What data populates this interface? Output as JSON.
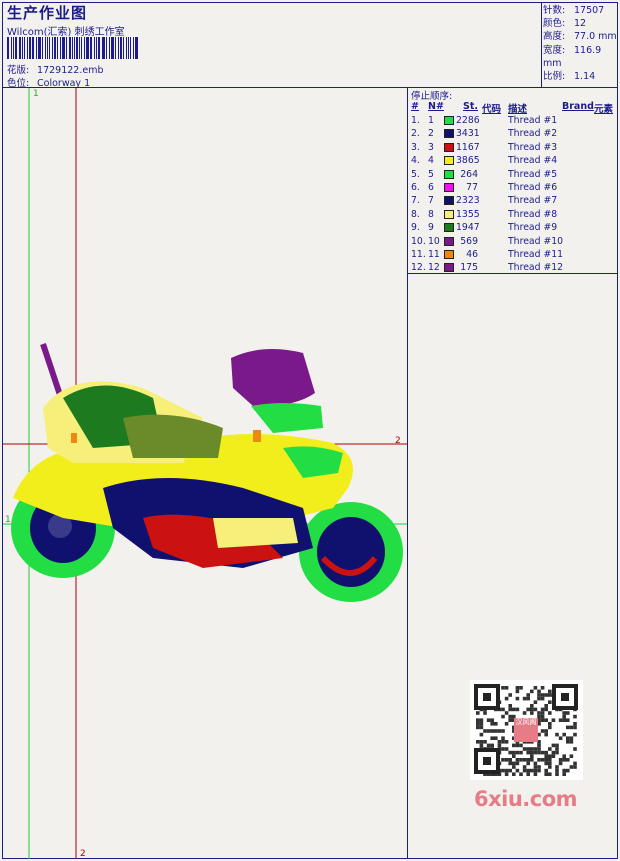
{
  "header": {
    "title": "生产作业图",
    "subtitle": "Wilcom(汇索) 刺绣工作室",
    "design_label": "花版:",
    "design_value": "1729122.emb",
    "colorway_label": "色位:",
    "colorway_value": "Colorway 1"
  },
  "stats": [
    {
      "label": "针数:",
      "value": "17507"
    },
    {
      "label": "颜色:",
      "value": "12"
    },
    {
      "label": "高度:",
      "value": "77.0 mm"
    },
    {
      "label": "宽度:",
      "value": "116.9 mm"
    },
    {
      "label": "比例:",
      "value": "1.14"
    }
  ],
  "stop_sequence": {
    "title": "停止顺序:",
    "headers": {
      "seq": "#",
      "num": "N#",
      "stitches": "St.",
      "code": "代码",
      "desc": "描述",
      "brand": "Brand",
      "element": "元素"
    },
    "rows": [
      {
        "seq": "1.",
        "num": "1",
        "color": "#22dd44",
        "stitches": "2286",
        "desc": "Thread #1"
      },
      {
        "seq": "2.",
        "num": "2",
        "color": "#10106e",
        "stitches": "3431",
        "desc": "Thread #2"
      },
      {
        "seq": "3.",
        "num": "3",
        "color": "#cc1111",
        "stitches": "1167",
        "desc": "Thread #3"
      },
      {
        "seq": "4.",
        "num": "4",
        "color": "#f2ee1c",
        "stitches": "3865",
        "desc": "Thread #4"
      },
      {
        "seq": "5.",
        "num": "5",
        "color": "#22dd44",
        "stitches": "264",
        "desc": "Thread #5"
      },
      {
        "seq": "6.",
        "num": "6",
        "color": "#ee11ee",
        "stitches": "77",
        "desc": "Thread #6"
      },
      {
        "seq": "7.",
        "num": "7",
        "color": "#10106e",
        "stitches": "2323",
        "desc": "Thread #7"
      },
      {
        "seq": "8.",
        "num": "8",
        "color": "#f6f07a",
        "stitches": "1355",
        "desc": "Thread #8"
      },
      {
        "seq": "9.",
        "num": "9",
        "color": "#1e7a1e",
        "stitches": "1947",
        "desc": "Thread #9"
      },
      {
        "seq": "10.",
        "num": "10",
        "color": "#7a1a8a",
        "stitches": "569",
        "desc": "Thread #10"
      },
      {
        "seq": "11.",
        "num": "11",
        "color": "#ee8811",
        "stitches": "46",
        "desc": "Thread #11"
      },
      {
        "seq": "12.",
        "num": "12",
        "color": "#7a1a8a",
        "stitches": "175",
        "desc": "Thread #12"
      }
    ]
  },
  "guides": {
    "label_1": "1",
    "label_2": "2",
    "guide_1_color": "#22cc33",
    "guide_2_color": "#aa0000"
  },
  "watermark": {
    "text": "6xiu.com",
    "stamp": "汉风阁"
  }
}
